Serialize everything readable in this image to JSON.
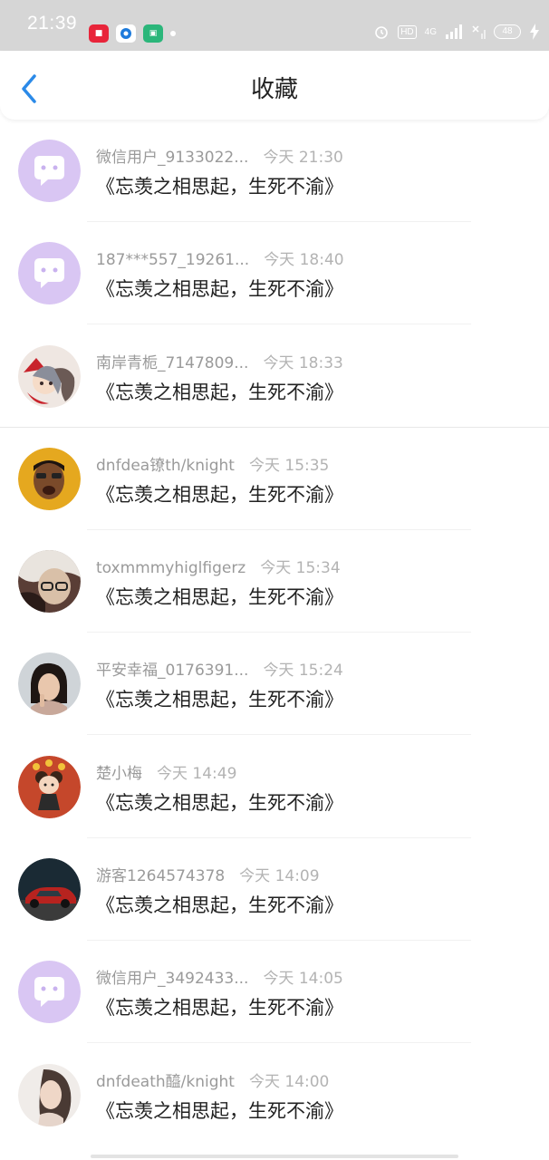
{
  "status_bar": {
    "time": "21:39",
    "apps": [
      {
        "name": "app-icon-red",
        "color": "#e8253a"
      },
      {
        "name": "app-icon-blue",
        "color": "#1e7bdc"
      },
      {
        "name": "app-icon-green",
        "color": "#2bb67a"
      }
    ],
    "hd": "HD",
    "network": "4G",
    "battery": "48"
  },
  "header": {
    "back_icon": "chevron-left-icon",
    "title": "收藏"
  },
  "items": [
    {
      "name": "微信用户_9133022...",
      "time": "今天 21:30",
      "text": "《忘羡之相思起，生死不渝》",
      "avatar": "default"
    },
    {
      "name": "187***557_19261...",
      "time": "今天 18:40",
      "text": "《忘羡之相思起，生死不渝》",
      "avatar": "default"
    },
    {
      "name": "南岸青栀_7147809...",
      "time": "今天 18:33",
      "text": "《忘羡之相思起，生死不渝》",
      "avatar": "anime"
    },
    {
      "name": "dnfdea镣th/knight",
      "time": "今天 15:35",
      "text": "《忘羡之相思起，生死不渝》",
      "avatar": "man-yellow"
    },
    {
      "name": "toxmmmyhiglfigerz",
      "time": "今天 15:34",
      "text": "《忘羡之相思起，生死不渝》",
      "avatar": "blonde"
    },
    {
      "name": "平安幸福_0176391...",
      "time": "今天 15:24",
      "text": "《忘羡之相思起，生死不渝》",
      "avatar": "woman"
    },
    {
      "name": "楚小梅",
      "time": "今天 14:49",
      "text": "《忘羡之相思起，生死不渝》",
      "avatar": "cartoon-girl"
    },
    {
      "name": "游客1264574378",
      "time": "今天 14:09",
      "text": "《忘羡之相思起，生死不渝》",
      "avatar": "car"
    },
    {
      "name": "微信用户_3492433...",
      "time": "今天 14:05",
      "text": "《忘羡之相思起，生死不渝》",
      "avatar": "default"
    },
    {
      "name": "dnfdeath醯/knight",
      "time": "今天 14:00",
      "text": "《忘羡之相思起，生死不渝》",
      "avatar": "portrait"
    }
  ],
  "colors": {
    "accent": "#2b8ae8",
    "default_avatar_bg": "#d9c6f3"
  }
}
